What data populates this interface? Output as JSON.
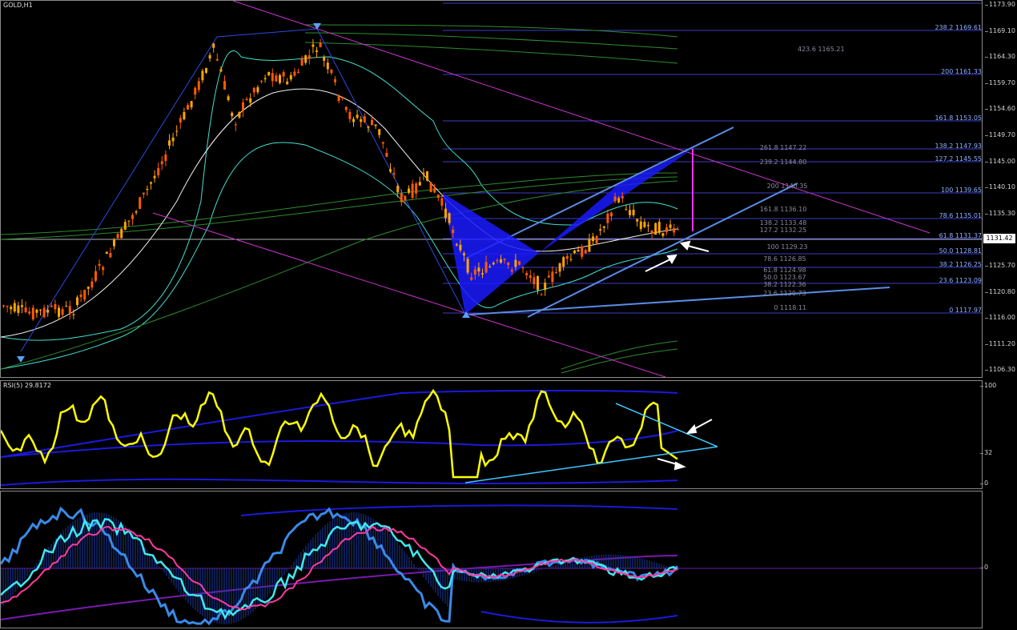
{
  "chart_title": "GOLD,H1",
  "rsi_label": "RSI(5) 29.8172",
  "current_price": "1131.42",
  "price_axis_ticks": [
    "1173.90",
    "1169.10",
    "1164.30",
    "1159.70",
    "1154.60",
    "1149.70",
    "1145.00",
    "1140.10",
    "1135.30",
    "1130.40",
    "1125.70",
    "1120.80",
    "1116.00",
    "1111.20",
    "1106.30"
  ],
  "rsi_axis_ticks": [
    "100",
    "32",
    "0"
  ],
  "osc_axis_ticks": [
    "0"
  ],
  "fib_right": [
    "238.2 1169.61",
    "200 1161.33",
    "161.8 1153.05",
    "138.2 1147.93",
    "127.2 1145.55",
    "100 1139.65",
    "78.6 1135.01",
    "61.8 1131.37",
    "50.0 1128.81",
    "38.2 1126.25",
    "23.6 1123.09",
    "0 1117.97"
  ],
  "fib_mid": [
    "423.6 1165.21",
    "261.8 1147.22",
    "239.2 1144.80",
    "200 1140.35",
    "161.8 1136.10",
    "138.2 1133.48",
    "127.2 1132.25",
    "100 1129.23",
    "78.6 1126.85",
    "61.8 1124.98",
    "50.0 1123.67",
    "38.2 1122.36",
    "23.6 1120.73",
    "0 1118.11"
  ],
  "colors": {
    "background": "#000000",
    "bull_candle": "#ffa500",
    "bear_candle": "#ff5a00",
    "fib_line": "#4a4ad8",
    "channel": "#cc33cc",
    "pattern": "#1a1aff",
    "rsi": "#ffff00",
    "trend": "#40c8ff"
  }
}
